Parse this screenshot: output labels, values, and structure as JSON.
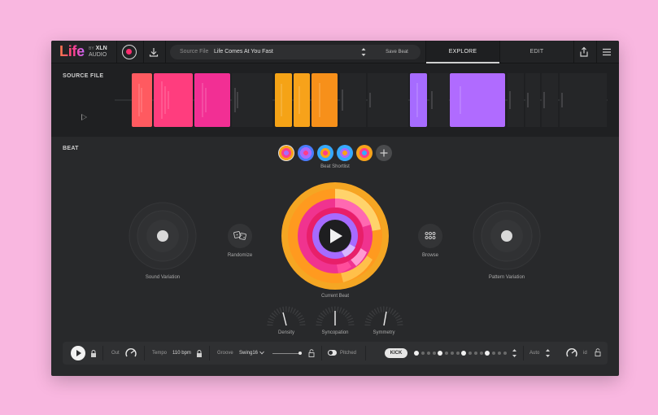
{
  "app": {
    "logo": "Life",
    "logo_by": "BY",
    "logo_brand_1": "XLN",
    "logo_brand_2": "AUDIO"
  },
  "toolbar": {
    "source_file_label": "Source File",
    "source_file_value": "Life Comes At You Fast",
    "save_beat_label": "Save Beat"
  },
  "tabs": [
    {
      "label": "EXPLORE",
      "active": true
    },
    {
      "label": "EDIT",
      "active": false
    }
  ],
  "source": {
    "title": "SOURCE FILE"
  },
  "beat": {
    "title": "BEAT",
    "shortlist_label": "Beat Shortlist",
    "sound_variation_label": "Sound Variation",
    "randomize_label": "Randomize",
    "current_beat_label": "Current Beat",
    "browse_label": "Browse",
    "pattern_variation_label": "Pattern Variation",
    "knobs": [
      {
        "label": "Density"
      },
      {
        "label": "Syncopation"
      },
      {
        "label": "Symmetry"
      }
    ]
  },
  "bottom": {
    "out_label": "Out",
    "tempo_label": "Tempo",
    "tempo_value": "110 bpm",
    "groove_label": "Groove",
    "groove_value": "Swing16",
    "pitched_label": "Pitched",
    "kick_label": "KICK",
    "auto_label": "Auto",
    "id_label": "id"
  },
  "colors": {
    "background": "#f9b7e0",
    "panel": "#28292b",
    "accent_pink": "#ff3d8a",
    "accent_orange": "#f7a21a",
    "accent_purple": "#a66bff"
  }
}
